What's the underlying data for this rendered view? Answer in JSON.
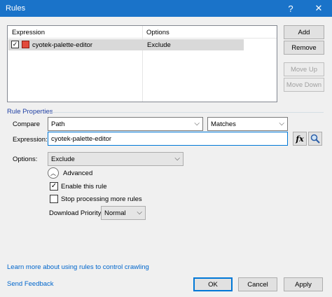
{
  "window": {
    "title": "Rules",
    "help_label": "?",
    "close_label": "✕"
  },
  "rules_list": {
    "columns": [
      "Expression",
      "Options"
    ],
    "rows": [
      {
        "expression": "cyotek-palette-editor",
        "options": "Exclude",
        "checked": true
      }
    ]
  },
  "buttons": {
    "add": "Add",
    "remove": "Remove",
    "move_up": "Move Up",
    "move_down": "Move Down",
    "ok": "OK",
    "cancel": "Cancel",
    "apply": "Apply"
  },
  "rule_properties": {
    "group_label": "Rule Properties",
    "compare_label": "Compare",
    "compare_value": "Path",
    "match_value": "Matches",
    "expression_label": "Expression:",
    "expression_value": "cyotek-palette-editor",
    "fx_label": "fx",
    "options_label": "Options:",
    "options_value": "Exclude",
    "advanced_label": "Advanced",
    "enable_label": "Enable this rule",
    "enable_checked": true,
    "stop_label": "Stop processing more rules",
    "stop_checked": false,
    "priority_label": "Download Priority",
    "priority_value": "Normal"
  },
  "links": {
    "learn_more": "Learn more about using rules to control crawling",
    "feedback": "Send Feedback"
  },
  "colors": {
    "titlebar": "#1a73c9",
    "link": "#0066cc",
    "group_label": "#1f3fa3",
    "accent": "#0078d7"
  }
}
